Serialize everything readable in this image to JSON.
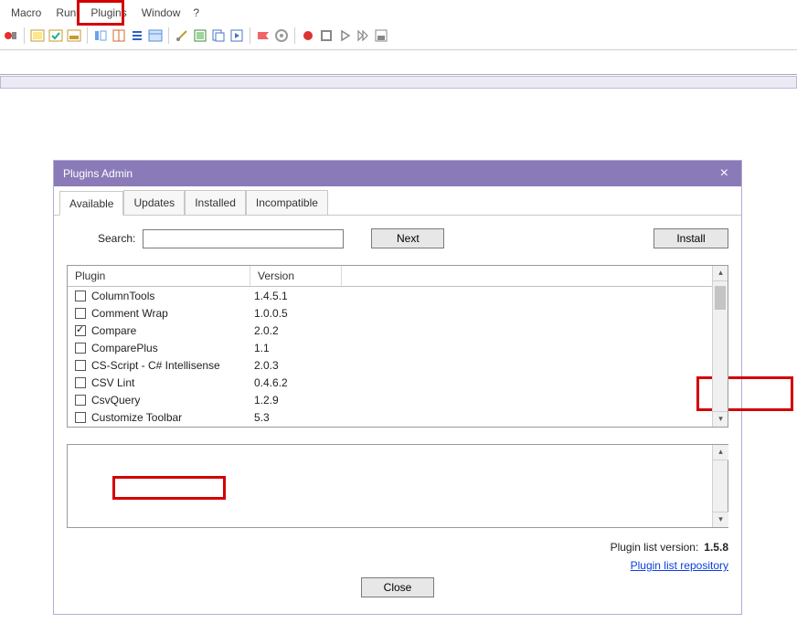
{
  "menubar": {
    "items": [
      "Macro",
      "Run",
      "Plugins",
      "Window",
      "?"
    ]
  },
  "dialog": {
    "title": "Plugins Admin",
    "tabs": [
      "Available",
      "Updates",
      "Installed",
      "Incompatible"
    ],
    "active_tab": 0,
    "search_label": "Search:",
    "search_value": "",
    "next_label": "Next",
    "install_label": "Install",
    "columns": {
      "plugin": "Plugin",
      "version": "Version"
    },
    "rows": [
      {
        "name": "ColumnTools",
        "version": "1.4.5.1",
        "checked": false
      },
      {
        "name": "Comment Wrap",
        "version": "1.0.0.5",
        "checked": false
      },
      {
        "name": "Compare",
        "version": "2.0.2",
        "checked": true
      },
      {
        "name": "ComparePlus",
        "version": "1.1",
        "checked": false
      },
      {
        "name": "CS-Script - C# Intellisense",
        "version": "2.0.3",
        "checked": false
      },
      {
        "name": "CSV Lint",
        "version": "0.4.6.2",
        "checked": false
      },
      {
        "name": "CsvQuery",
        "version": "1.2.9",
        "checked": false
      },
      {
        "name": "Customize Toolbar",
        "version": "5.3",
        "checked": false
      }
    ],
    "footer_version_label": "Plugin list version:",
    "footer_version_value": "1.5.8",
    "footer_link": "Plugin list repository",
    "close_label": "Close"
  }
}
